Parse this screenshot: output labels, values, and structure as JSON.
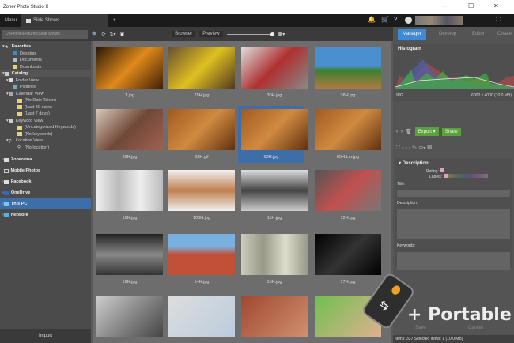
{
  "window": {
    "title": "Zoner Photo Studio X"
  },
  "tabs": {
    "menu": "Menu",
    "active": "Slide Shows",
    "new_tab": "+"
  },
  "toolbar": {
    "path": "D:\\Profile\\Pictures\\Slide Shows",
    "browser": "Browser",
    "preview": "Preview"
  },
  "modes": [
    "Manager",
    "Develop",
    "Editor",
    "Create"
  ],
  "sidebar": {
    "favorites": "Favorites",
    "fav_items": [
      "Desktop",
      "Documents",
      "Downloads"
    ],
    "catalog": "Catalog",
    "folder_view": "Folder View",
    "pictures": "Pictures",
    "calendar_view": "Calendar View",
    "cal_items": [
      "(No Date Taken)",
      "(Last 30 days)",
      "(Last 7 days)"
    ],
    "keyword_view": "Keyword View",
    "kw_items": [
      "(Uncategorized Keywords)",
      "(No keywords)"
    ],
    "location_view": "Location View",
    "loc_items": [
      "(No location)"
    ],
    "roots": [
      "Zonerama",
      "Mobile Photos",
      "Facebook",
      "OneDrive",
      "This PC",
      "Network"
    ],
    "import": "Import"
  },
  "grid": {
    "files": [
      "1.jpg",
      "25H.jpg",
      "30H.jpg",
      "38H.jpg",
      "39H.jpg",
      "63H.gif",
      "63H.jpg",
      "65H.Lm.jpg",
      "10H.jpg",
      "106H.jpg",
      "11H.jpg",
      "12H.jpg",
      "12H.jpg",
      "14H.jpg",
      "15H.jpg",
      "17H.jpg",
      "",
      "",
      "",
      ""
    ],
    "selected_index": 6
  },
  "panel": {
    "histogram": "Histogram",
    "format": "JPG",
    "dimensions": "6000 x 4000 (10.0 MB)",
    "export": "Export",
    "share": "Share",
    "description": "Description",
    "rating": "Rating:",
    "labels": "Labels:",
    "title": "Title:",
    "description_field": "Description:",
    "keywords": "Keywords:",
    "save": "Save",
    "cancel": "Cancel"
  },
  "status": "Items: 337   Selected items: 1 (10.0 MB)",
  "badge": "+ Portable",
  "colors": {
    "accent": "#3d6ea8",
    "green": "#5aa33a"
  }
}
